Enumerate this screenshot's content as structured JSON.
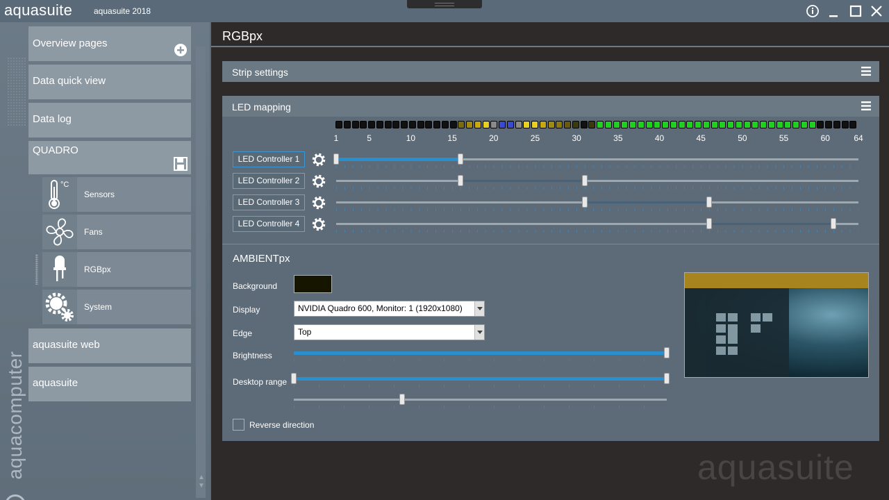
{
  "titlebar": {
    "app_name": "aquasuite",
    "version": "aquasuite 2018",
    "buttons": [
      "info-icon",
      "minimize-icon",
      "maximize-icon",
      "close-icon"
    ]
  },
  "sidebar": {
    "brand": "aquacomputer",
    "items": [
      {
        "label": "Overview pages",
        "icon": "plus-circle-icon"
      },
      {
        "label": "Data quick view"
      },
      {
        "label": "Data log"
      },
      {
        "label": "QUADRO",
        "icon": "save-icon"
      },
      {
        "label": "aquasuite web"
      },
      {
        "label": "aquasuite"
      }
    ],
    "subitems": [
      {
        "label": "Sensors",
        "icon": "thermometer-icon",
        "unit": "°C"
      },
      {
        "label": "Fans",
        "icon": "fan-icon"
      },
      {
        "label": "RGBpx",
        "icon": "led-icon"
      },
      {
        "label": "System",
        "icon": "gears-icon"
      }
    ]
  },
  "main": {
    "title": "RGBpx",
    "strip_panel": {
      "title": "Strip settings"
    },
    "led_panel": {
      "title": "LED mapping",
      "led_count": 64,
      "led_colors": [
        "#111",
        "#111",
        "#111",
        "#111",
        "#111",
        "#111",
        "#111",
        "#111",
        "#111",
        "#111",
        "#111",
        "#111",
        "#111",
        "#111",
        "#111",
        "#7a6a10",
        "#a08a10",
        "#c8a810",
        "#e8d020",
        "#8a8a8a",
        "#3a4ad0",
        "#3a4ad0",
        "#8a8a8a",
        "#e8d020",
        "#e8d020",
        "#c8a810",
        "#a08a10",
        "#8a7a10",
        "#6a5a10",
        "#3a3a10",
        "#111",
        "#3a3a10",
        "#20d020",
        "#20d020",
        "#20d020",
        "#20d020",
        "#20d020",
        "#20d020",
        "#20d020",
        "#20d020",
        "#20d020",
        "#20d020",
        "#20d020",
        "#20d020",
        "#20d020",
        "#20d020",
        "#20d020",
        "#20d020",
        "#20d020",
        "#20d020",
        "#20d020",
        "#20d020",
        "#20d020",
        "#20d020",
        "#20d020",
        "#20d020",
        "#20d020",
        "#20d020",
        "#20d020",
        "#111",
        "#111",
        "#111",
        "#111",
        "#111"
      ],
      "scale_labels": [
        "1",
        "5",
        "10",
        "15",
        "20",
        "25",
        "30",
        "35",
        "40",
        "45",
        "50",
        "55",
        "60",
        "64"
      ],
      "controllers": [
        {
          "label": "LED Controller 1",
          "start": 1,
          "end": 16,
          "active": true
        },
        {
          "label": "LED Controller 2",
          "start": 16,
          "end": 31,
          "active": false
        },
        {
          "label": "LED Controller 3",
          "start": 31,
          "end": 46,
          "active": false
        },
        {
          "label": "LED Controller 4",
          "start": 46,
          "end": 61,
          "active": false
        }
      ]
    },
    "ambient": {
      "title": "AMBIENTpx",
      "background_label": "Background",
      "background_color": "#151500",
      "display_label": "Display",
      "display_value": "NVIDIA Quadro 600, Monitor: 1 (1920x1080)",
      "edge_label": "Edge",
      "edge_value": "Top",
      "brightness_label": "Brightness",
      "brightness": 1.0,
      "range_label": "Desktop range",
      "range_start": 0.0,
      "range_end": 1.0,
      "second_slider": 0.29,
      "reverse_label": "Reverse direction",
      "reverse_checked": false
    }
  },
  "watermark": "aquasuite",
  "colors": {
    "accent": "#2a8fce",
    "sidebar": "#8d99a3",
    "panel": "#5d6b78",
    "background": "#2f2a2a"
  }
}
